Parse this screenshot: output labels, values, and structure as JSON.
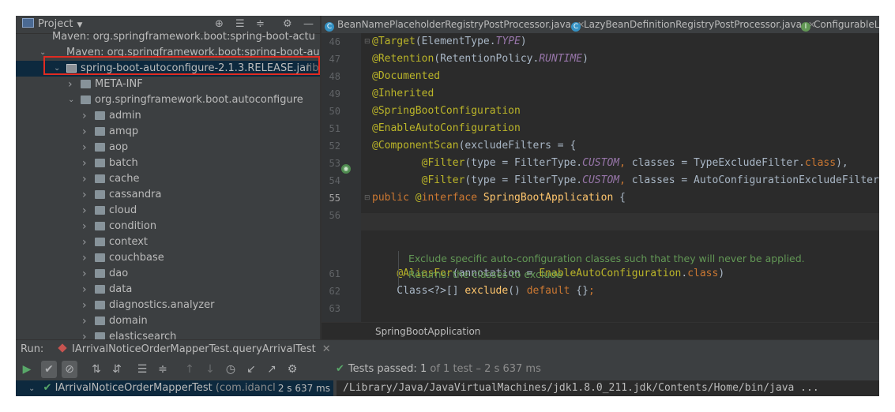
{
  "project_panel": {
    "title": "Project",
    "tree": [
      {
        "label": "Maven: org.springframework.boot:spring-boot-actu",
        "indent": 0,
        "icon": "library",
        "arrow": "none"
      },
      {
        "label": "Maven: org.springframework.boot:spring-boot-autc",
        "indent": 1,
        "icon": "library",
        "arrow": "expanded"
      },
      {
        "label": "spring-boot-autoconfigure-2.1.3.RELEASE.jar",
        "suffix": "libr",
        "indent": 2,
        "icon": "jar",
        "arrow": "expanded",
        "selected": true
      },
      {
        "label": "META-INF",
        "indent": 3,
        "icon": "folder",
        "arrow": "collapsed"
      },
      {
        "label": "org.springframework.boot.autoconfigure",
        "indent": 3,
        "icon": "folder",
        "arrow": "expanded"
      },
      {
        "label": "admin",
        "indent": 4,
        "icon": "folder",
        "arrow": "collapsed"
      },
      {
        "label": "amqp",
        "indent": 4,
        "icon": "folder",
        "arrow": "collapsed"
      },
      {
        "label": "aop",
        "indent": 4,
        "icon": "folder",
        "arrow": "collapsed"
      },
      {
        "label": "batch",
        "indent": 4,
        "icon": "folder",
        "arrow": "collapsed"
      },
      {
        "label": "cache",
        "indent": 4,
        "icon": "folder",
        "arrow": "collapsed"
      },
      {
        "label": "cassandra",
        "indent": 4,
        "icon": "folder",
        "arrow": "collapsed"
      },
      {
        "label": "cloud",
        "indent": 4,
        "icon": "folder",
        "arrow": "collapsed"
      },
      {
        "label": "condition",
        "indent": 4,
        "icon": "folder",
        "arrow": "collapsed"
      },
      {
        "label": "context",
        "indent": 4,
        "icon": "folder",
        "arrow": "collapsed"
      },
      {
        "label": "couchbase",
        "indent": 4,
        "icon": "folder",
        "arrow": "collapsed"
      },
      {
        "label": "dao",
        "indent": 4,
        "icon": "folder",
        "arrow": "collapsed"
      },
      {
        "label": "data",
        "indent": 4,
        "icon": "folder",
        "arrow": "collapsed"
      },
      {
        "label": "diagnostics.analyzer",
        "indent": 4,
        "icon": "folder",
        "arrow": "collapsed"
      },
      {
        "label": "domain",
        "indent": 4,
        "icon": "folder",
        "arrow": "collapsed"
      },
      {
        "label": "elasticsearch",
        "indent": 4,
        "icon": "folder",
        "arrow": "collapsed"
      }
    ]
  },
  "editor_tabs": [
    {
      "label": "BeanNamePlaceholderRegistryPostProcessor.java",
      "icon": "C",
      "closable": true
    },
    {
      "label": "LazyBeanDefinitionRegistryPostProcessor.java",
      "icon": "C",
      "closable": true
    },
    {
      "label": "ConfigurableLis",
      "icon": "I",
      "closable": false
    }
  ],
  "editor": {
    "lines": [
      {
        "n": "46",
        "parts": [
          [
            "an",
            "@Target"
          ],
          [
            "p",
            "(ElementType."
          ],
          [
            "it",
            "TYPE"
          ],
          [
            "p",
            ")"
          ]
        ]
      },
      {
        "n": "47",
        "parts": [
          [
            "an",
            "@Retention"
          ],
          [
            "p",
            "(RetentionPolicy."
          ],
          [
            "it",
            "RUNTIME"
          ],
          [
            "p",
            ")"
          ]
        ]
      },
      {
        "n": "48",
        "parts": [
          [
            "an",
            "@Documented"
          ]
        ]
      },
      {
        "n": "49",
        "parts": [
          [
            "an",
            "@Inherited"
          ]
        ]
      },
      {
        "n": "50",
        "parts": [
          [
            "an",
            "@SpringBootConfiguration"
          ]
        ]
      },
      {
        "n": "51",
        "parts": [
          [
            "an",
            "@EnableAutoConfiguration"
          ]
        ]
      },
      {
        "n": "52",
        "parts": [
          [
            "an",
            "@ComponentScan"
          ],
          [
            "p",
            "(excludeFilters = {"
          ]
        ]
      },
      {
        "n": "53",
        "parts": [
          [
            "p",
            "        "
          ],
          [
            "an",
            "@Filter"
          ],
          [
            "p",
            "(type = FilterType."
          ],
          [
            "it",
            "CUSTOM"
          ],
          [
            "kw",
            ","
          ],
          [
            "p",
            " classes = TypeExcludeFilter."
          ],
          [
            "kw",
            "class"
          ],
          [
            "p",
            "),"
          ]
        ]
      },
      {
        "n": "54",
        "parts": [
          [
            "p",
            "        "
          ],
          [
            "an",
            "@Filter"
          ],
          [
            "p",
            "(type = FilterType."
          ],
          [
            "it",
            "CUSTOM"
          ],
          [
            "kw",
            ","
          ],
          [
            "p",
            " classes = AutoConfigurationExcludeFilter.class) })"
          ]
        ]
      },
      {
        "n": "55",
        "parts": [
          [
            "kw",
            "public "
          ],
          [
            "an",
            "@"
          ],
          [
            "kw",
            "interface "
          ],
          [
            "cls",
            "SpringBootApplication"
          ],
          [
            "p",
            " {"
          ]
        ]
      },
      {
        "n": "56",
        "parts": []
      },
      {
        "n": "61",
        "parts": [
          [
            "p",
            "    "
          ],
          [
            "an",
            "@AliasFor"
          ],
          [
            "p",
            "(annotation = "
          ],
          [
            "an",
            "EnableAutoConfiguration"
          ],
          [
            "p",
            "."
          ],
          [
            "kw",
            "class"
          ],
          [
            "p",
            ")"
          ]
        ]
      },
      {
        "n": "62",
        "parts": [
          [
            "p",
            "    Class<?>[] "
          ],
          [
            "cls",
            "exclude"
          ],
          [
            "p",
            "() "
          ],
          [
            "kw",
            "default"
          ],
          [
            "p",
            " {}"
          ],
          [
            "kw",
            ";"
          ]
        ]
      },
      {
        "n": "63",
        "parts": []
      }
    ],
    "doc_comment": [
      "Exclude specific auto-configuration classes such that they will never be applied.",
      "Returns: the classes to exclude"
    ],
    "breadcrumb": "SpringBootApplication"
  },
  "run_panel": {
    "label": "Run:",
    "tab": "IArrivalNoticeOrderMapperTest.queryArrivalTest",
    "status_prefix": "Tests passed:",
    "status_count": "1",
    "status_rest": "of 1 test – 2 s 637 ms",
    "test_name": "IArrivalNoticeOrderMapperTest",
    "test_pkg": "(com.idancl",
    "test_time": "2 s 637 ms",
    "console": "/Library/Java/JavaVirtualMachines/jdk1.8.0_211.jdk/Contents/Home/bin/java ..."
  }
}
